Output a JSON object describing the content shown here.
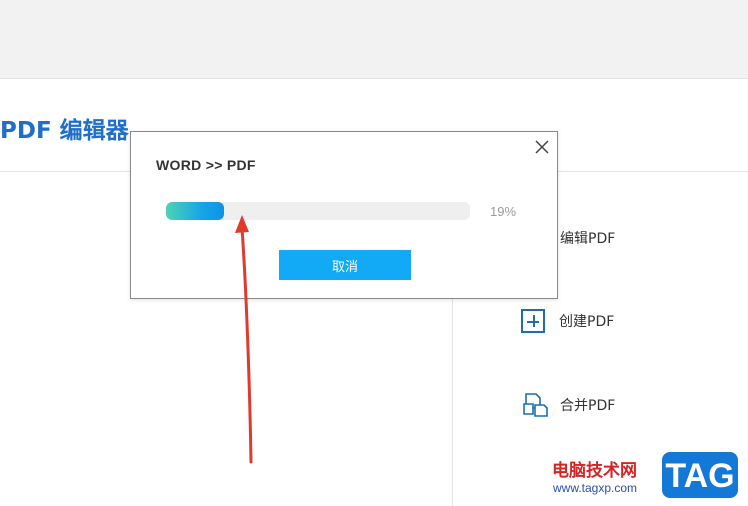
{
  "app": {
    "title": "PDF 编辑器"
  },
  "sidebar": {
    "items": [
      {
        "label": "编辑PDF",
        "icon": "edit-pdf-icon"
      },
      {
        "label": "创建PDF",
        "icon": "plus-square-icon"
      },
      {
        "label": "合并PDF",
        "icon": "merge-pdf-icon"
      }
    ]
  },
  "dialog": {
    "title": "WORD >> PDF",
    "progress_percent": 19,
    "progress_label": "19%",
    "cancel_label": "取消",
    "close_icon": "close-icon"
  },
  "colors": {
    "title_blue": "#1f6fc9",
    "button_blue": "#12a9f6",
    "progress_start": "#4fd2b4",
    "progress_end": "#0d93e3",
    "annotation_red": "#e03a2e"
  },
  "watermark": {
    "site_cn": "电脑技术网",
    "url": "www.tagxp.com",
    "tag": "TAG"
  }
}
